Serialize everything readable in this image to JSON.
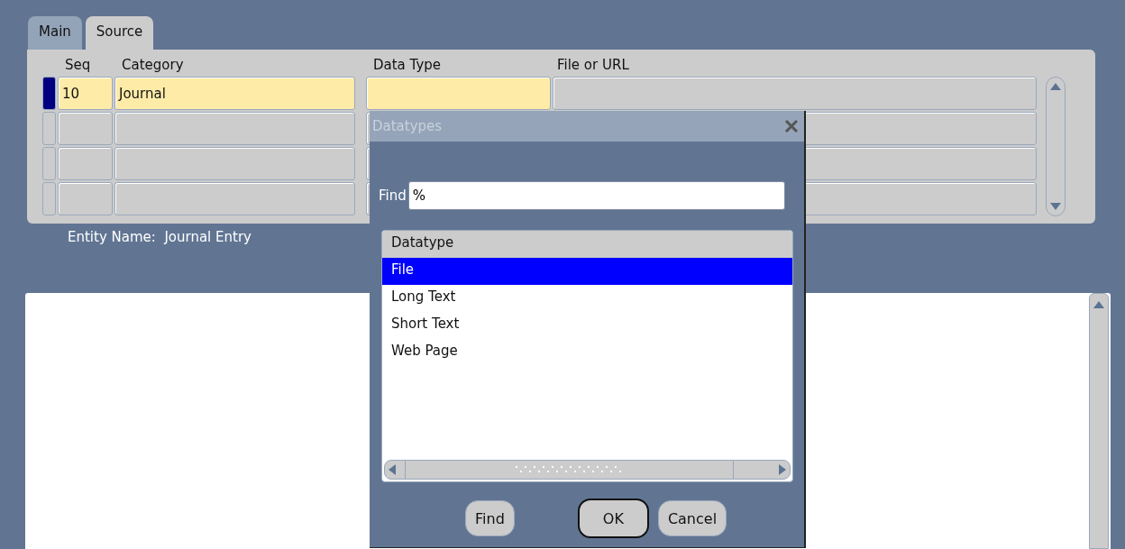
{
  "tabs": [
    {
      "label": "Main",
      "selected": false
    },
    {
      "label": "Source",
      "selected": true
    }
  ],
  "table": {
    "columns": [
      "Seq",
      "Category",
      "Data Type",
      "File or URL"
    ],
    "rows": [
      {
        "current": true,
        "seq": "10",
        "category": "Journal"
      },
      {
        "current": false
      },
      {
        "current": false
      },
      {
        "current": false
      }
    ]
  },
  "entity_name": "Entity Name:  Journal Entry",
  "dialog": {
    "title": "Datatypes",
    "find_label": "Find",
    "find_value": "%",
    "list_header": "Datatype",
    "items": [
      {
        "label": "File",
        "selected": true
      },
      {
        "label": "Long Text",
        "selected": false
      },
      {
        "label": "Short Text",
        "selected": false
      },
      {
        "label": "Web Page",
        "selected": false
      }
    ],
    "buttons": [
      {
        "label": "Find",
        "default": false
      },
      {
        "label": "OK",
        "default": true
      },
      {
        "label": "Cancel",
        "default": false
      }
    ]
  }
}
